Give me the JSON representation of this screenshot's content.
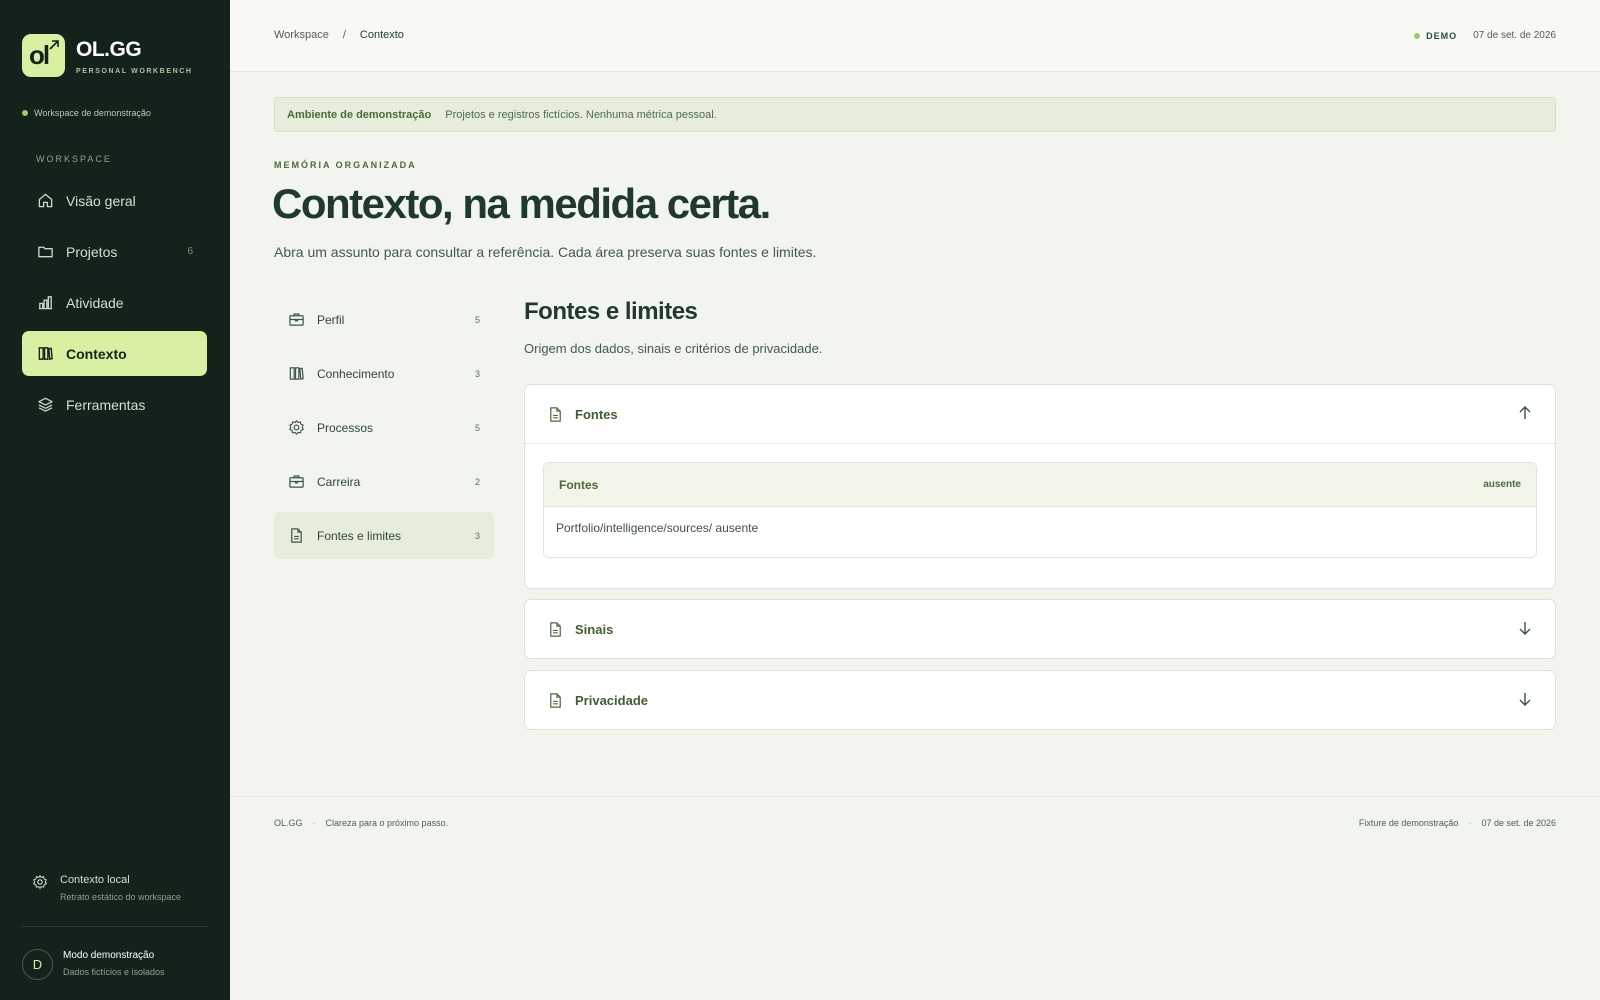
{
  "brand": {
    "logo_text": "ol",
    "name": "OL.GG",
    "subtitle": "PERSONAL WORKBENCH"
  },
  "workspace_tag": "Workspace de demonstração",
  "sidebar": {
    "section_label": "WORKSPACE",
    "items": [
      {
        "label": "Visão geral",
        "icon": "home-icon",
        "count": ""
      },
      {
        "label": "Projetos",
        "icon": "folder-icon",
        "count": "6"
      },
      {
        "label": "Atividade",
        "icon": "bar-chart-icon",
        "count": ""
      },
      {
        "label": "Contexto",
        "icon": "books-icon",
        "count": "",
        "active": true
      },
      {
        "label": "Ferramentas",
        "icon": "layers-icon",
        "count": ""
      }
    ],
    "local_context": {
      "title": "Contexto local",
      "subtitle": "Retrato estático do workspace"
    },
    "user": {
      "initial": "D",
      "title": "Modo demonstração",
      "subtitle": "Dados fictícios e isolados"
    }
  },
  "topbar": {
    "breadcrumb": [
      "Workspace",
      "/",
      "Contexto"
    ],
    "badge": "DEMO",
    "date": "07 de set. de 2026"
  },
  "banner": {
    "title": "Ambiente de demonstração",
    "text": "Projetos e registros fictícios. Nenhuma métrica pessoal."
  },
  "page": {
    "eyebrow": "MEMÓRIA ORGANIZADA",
    "title": "Contexto, na medida certa.",
    "subtitle": "Abra um assunto para consultar a referência. Cada área preserva suas fontes e limites."
  },
  "categories": [
    {
      "label": "Perfil",
      "icon": "briefcase-icon",
      "count": "5"
    },
    {
      "label": "Conhecimento",
      "icon": "books-icon",
      "count": "3"
    },
    {
      "label": "Processos",
      "icon": "gear-icon",
      "count": "5"
    },
    {
      "label": "Carreira",
      "icon": "briefcase-icon",
      "count": "2"
    },
    {
      "label": "Fontes e limites",
      "icon": "document-icon",
      "count": "3",
      "active": true
    }
  ],
  "section": {
    "title": "Fontes e limites",
    "subtitle": "Origem dos dados, sinais e critérios de privacidade.",
    "accordions": [
      {
        "label": "Fontes",
        "expanded": true,
        "inner": {
          "title": "Fontes",
          "status": "ausente",
          "body": "Portfolio/intelligence/sources/ ausente"
        }
      },
      {
        "label": "Sinais",
        "expanded": false
      },
      {
        "label": "Privacidade",
        "expanded": false
      }
    ]
  },
  "footer": {
    "brand": "OL.GG",
    "sep": "·",
    "tagline": "Clareza para o próximo passo.",
    "fixture": "Fixture de demonstração",
    "date": "07 de set. de 2026"
  },
  "colors": {
    "sidebar_bg": "#13231c",
    "accent": "#d9f0a3",
    "text_dark": "#1f3a2c",
    "text_green": "#4b6a3a",
    "banner_bg": "#e6eedb"
  }
}
